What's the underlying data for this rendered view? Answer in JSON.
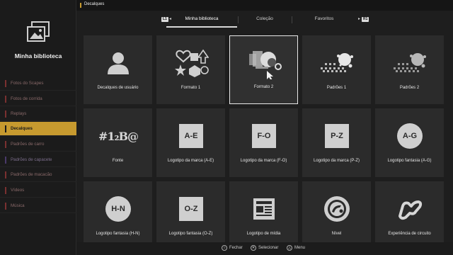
{
  "sidebar": {
    "title": "Minha biblioteca",
    "items": [
      {
        "label": "Fotos do Scapes",
        "state": "dim"
      },
      {
        "label": "Fotos de corrida",
        "state": "dim"
      },
      {
        "label": "Replays",
        "state": "dim"
      },
      {
        "label": "Decalques",
        "state": "active"
      },
      {
        "label": "Padrões de carro",
        "state": "dim"
      },
      {
        "label": "Padrões de capacete",
        "state": "purple"
      },
      {
        "label": "Padrões de macacão",
        "state": "dim"
      },
      {
        "label": "Vídeos",
        "state": "dim"
      },
      {
        "label": "Música",
        "state": "dim"
      }
    ]
  },
  "topbar": {
    "breadcrumb": "Decalques"
  },
  "tabs": {
    "left_badge": "L1",
    "right_badge": "R1",
    "items": [
      {
        "label": "Minha biblioteca",
        "active": true
      },
      {
        "label": "Coleção",
        "active": false
      },
      {
        "label": "Favoritos",
        "active": false
      }
    ]
  },
  "grid": {
    "cards": [
      {
        "label": "Decalques de usuário",
        "icon": "user-icon"
      },
      {
        "label": "Formato 1",
        "icon": "shapes-icon"
      },
      {
        "label": "Formato 2",
        "icon": "abstract-shapes-icon",
        "selected": true
      },
      {
        "label": "Padrões 1",
        "icon": "pattern-splash-icon"
      },
      {
        "label": "Padrões 2",
        "icon": "pattern-splash-icon"
      },
      {
        "label": "Fonte",
        "icon": "font-glyphs-icon",
        "glyph": "#1₂B@"
      },
      {
        "label": "Logotipo da marca (A-E)",
        "icon": "logo-square-icon",
        "glyph": "A-E"
      },
      {
        "label": "Logotipo da marca (F-O)",
        "icon": "logo-square-icon",
        "glyph": "F-O"
      },
      {
        "label": "Logotipo da marca (P-Z)",
        "icon": "logo-square-icon",
        "glyph": "P-Z"
      },
      {
        "label": "Logotipo fantasia (A-G)",
        "icon": "logo-circle-icon",
        "glyph": "A-G"
      },
      {
        "label": "Logotipo fantasia (H-N)",
        "icon": "logo-circle-icon",
        "glyph": "H-N"
      },
      {
        "label": "Logotipo fantasia (O-Z)",
        "icon": "logo-square-icon",
        "glyph": "O-Z"
      },
      {
        "label": "Logotipo de mídia",
        "icon": "newspaper-icon"
      },
      {
        "label": "Nível",
        "icon": "level-emblem-icon"
      },
      {
        "label": "Experiência de circuito",
        "icon": "circuit-track-icon"
      }
    ]
  },
  "footer": {
    "hints": [
      {
        "label": "Fechar",
        "button": "circle"
      },
      {
        "label": "Selecionar",
        "button": "cross"
      },
      {
        "label": "Menu",
        "button": "triangle"
      }
    ]
  },
  "colors": {
    "accent": "#c79a2f",
    "background": "#1e1e1e",
    "card": "#2b2b2b"
  }
}
